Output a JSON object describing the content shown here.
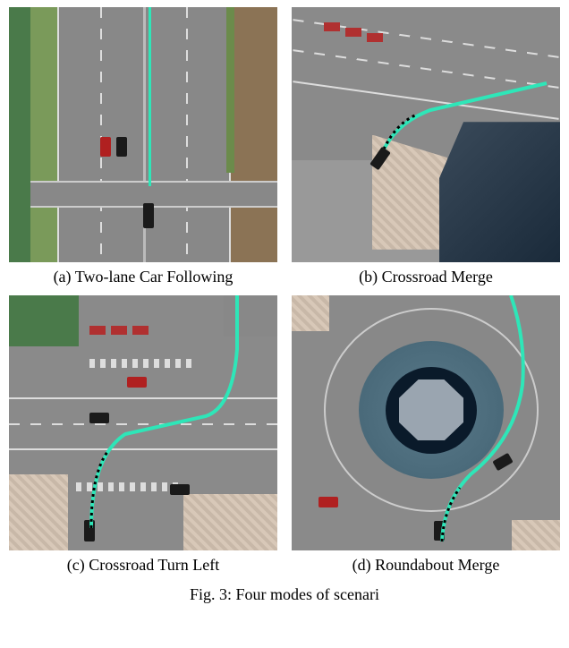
{
  "figure": {
    "subfigures": [
      {
        "label": "(a) Two-lane Car Following"
      },
      {
        "label": "(b) Crossroad Merge"
      },
      {
        "label": "(c) Crossroad Turn Left"
      },
      {
        "label": "(d) Roundabout Merge"
      }
    ],
    "main_caption_prefix": "Fig. 3: Four modes of scenari"
  }
}
